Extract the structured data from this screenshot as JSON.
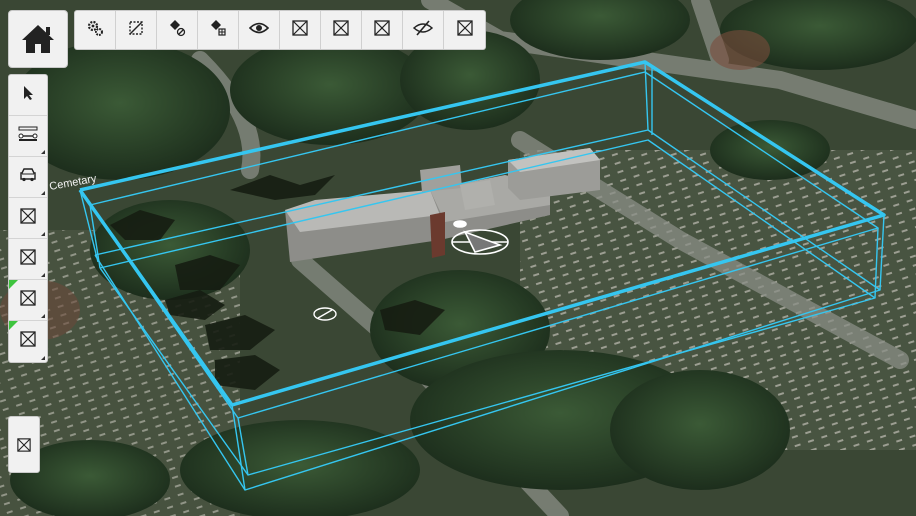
{
  "map": {
    "label": "Cemetary",
    "colors": {
      "ground": "#3a4734",
      "path": "#8a8e86",
      "tree": "#1f3322",
      "building_top": "#b9b9b6",
      "building_side": "#8d8d89",
      "box_outline": "#35c6f0"
    }
  },
  "home_button": {
    "icon": "home-icon"
  },
  "top_toolbar": {
    "buttons": [
      {
        "name": "settings-button",
        "icon": "gears-icon"
      },
      {
        "name": "transparency-button",
        "icon": "transparency-icon"
      },
      {
        "name": "fill-remove-button",
        "icon": "paint-bucket-remove-icon"
      },
      {
        "name": "fill-grid-button",
        "icon": "paint-bucket-grid-icon"
      },
      {
        "name": "visibility-button",
        "icon": "eye-icon"
      },
      {
        "name": "tool-6-button",
        "icon": "placeholder-box-icon"
      },
      {
        "name": "tool-7-button",
        "icon": "placeholder-box-icon"
      },
      {
        "name": "tool-8-button",
        "icon": "placeholder-box-icon"
      },
      {
        "name": "hide-button",
        "icon": "eye-slash-icon"
      },
      {
        "name": "tool-10-button",
        "icon": "placeholder-box-icon"
      }
    ]
  },
  "side_toolbar": {
    "buttons": [
      {
        "name": "select-button",
        "icon": "cursor-arrow-icon",
        "submenu": false,
        "flag": false
      },
      {
        "name": "measure-button",
        "icon": "measure-line-icon",
        "submenu": true,
        "flag": false
      },
      {
        "name": "vehicle-button",
        "icon": "car-icon",
        "submenu": true,
        "flag": false
      },
      {
        "name": "side-tool-4-button",
        "icon": "placeholder-box-icon",
        "submenu": true,
        "flag": false
      },
      {
        "name": "side-tool-5-button",
        "icon": "placeholder-box-icon",
        "submenu": true,
        "flag": false
      },
      {
        "name": "side-tool-6-button",
        "icon": "placeholder-box-icon",
        "submenu": true,
        "flag": true
      },
      {
        "name": "side-tool-7-button",
        "icon": "placeholder-box-icon",
        "submenu": true,
        "flag": true
      }
    ]
  },
  "bottom_tool": {
    "icon": "placeholder-box-icon"
  }
}
